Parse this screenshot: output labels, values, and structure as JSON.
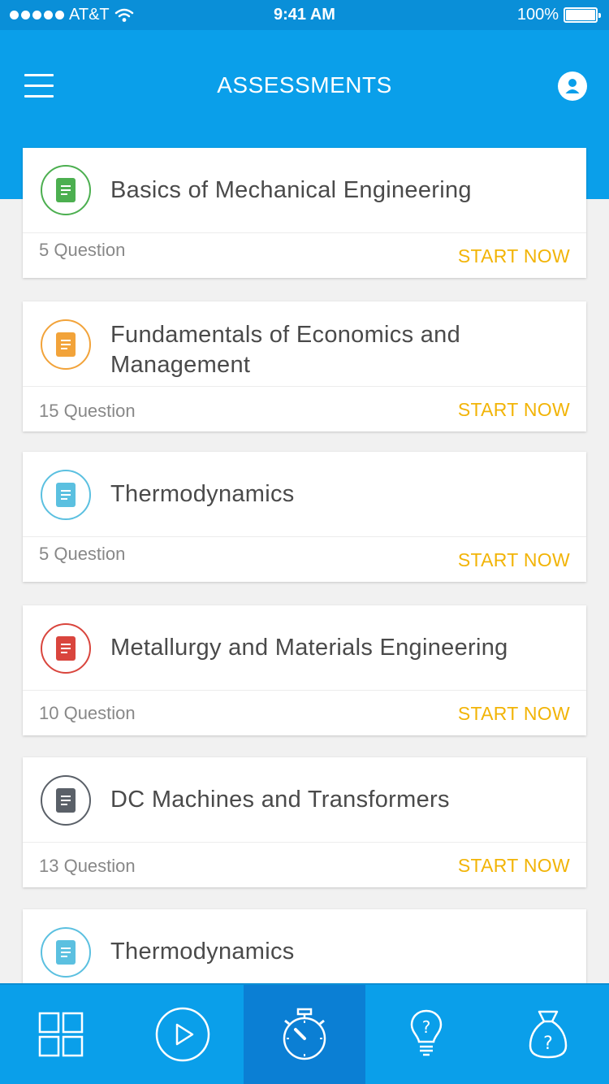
{
  "status_bar": {
    "carrier": "AT&T",
    "time": "9:41 AM",
    "battery": "100%"
  },
  "header": {
    "title": "ASSESSMENTS"
  },
  "assessments": [
    {
      "title": "Basics of Mechanical Engineering",
      "questions": "5 Question",
      "action": "START NOW",
      "color": "#4caf50"
    },
    {
      "title": "Fundamentals of Economics and Management",
      "questions": "15 Question",
      "action": "START NOW",
      "color": "#f2a33a"
    },
    {
      "title": "Thermodynamics",
      "questions": "5 Question",
      "action": "START NOW",
      "color": "#5bc0e0"
    },
    {
      "title": "Metallurgy and Materials Engineering",
      "questions": "10 Question",
      "action": "START NOW",
      "color": "#d9453d"
    },
    {
      "title": "DC Machines and Transformers",
      "questions": "13 Question",
      "action": "START NOW",
      "color": "#5a6068"
    },
    {
      "title": "Thermodynamics",
      "questions": "",
      "action": "",
      "color": "#5bc0e0"
    }
  ],
  "tab_bar": {
    "tabs": [
      {
        "icon": "grid-icon",
        "active": false
      },
      {
        "icon": "play-icon",
        "active": false
      },
      {
        "icon": "stopwatch-icon",
        "active": true
      },
      {
        "icon": "lightbulb-question-icon",
        "active": false
      },
      {
        "icon": "bag-question-icon",
        "active": false
      }
    ]
  },
  "colors": {
    "primary": "#0a9fea",
    "active_tab": "#0b7fd4",
    "accent": "#f2b407"
  }
}
